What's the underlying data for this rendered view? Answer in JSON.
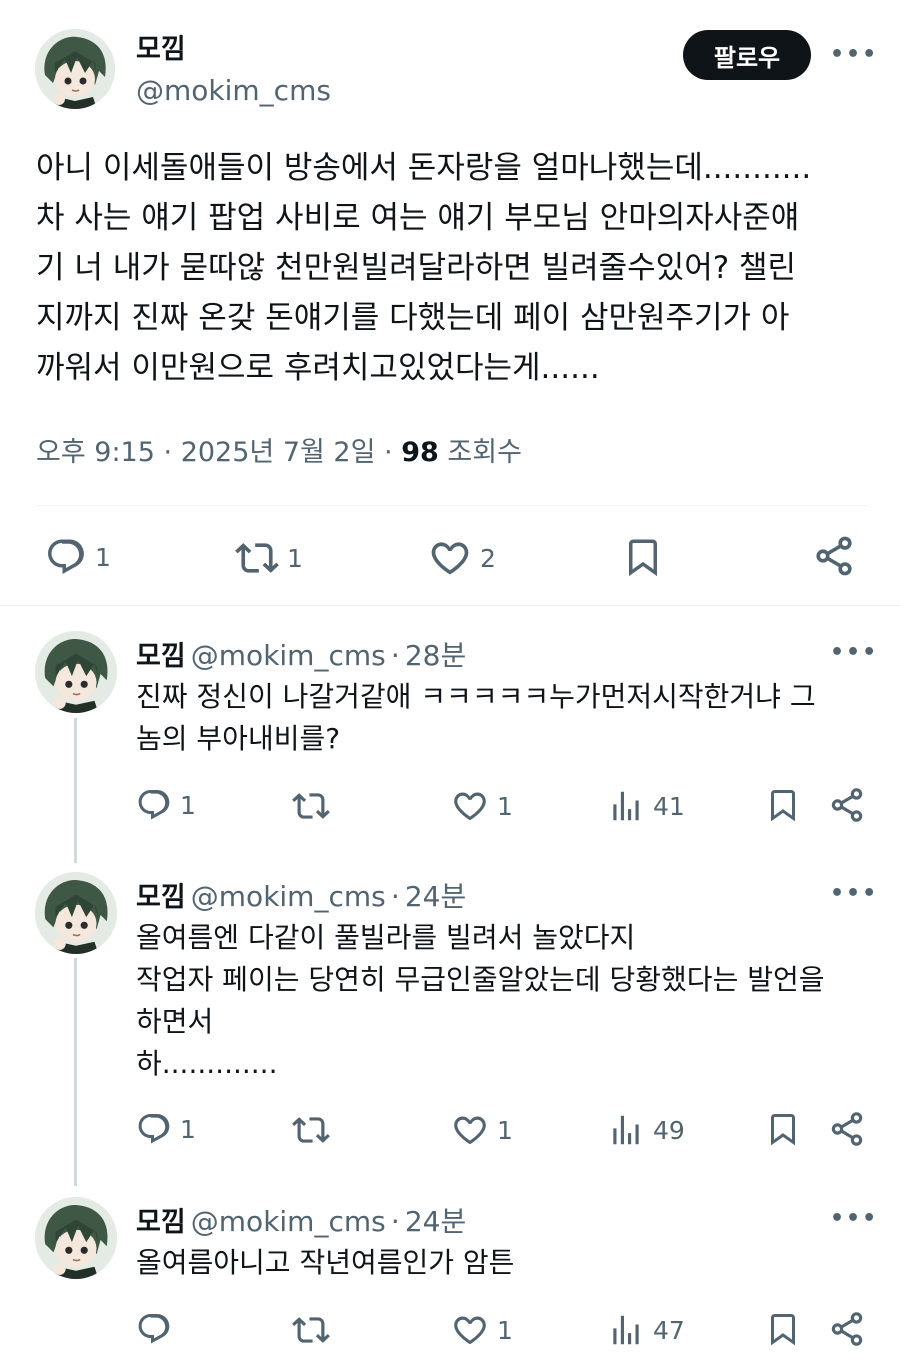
{
  "main_tweet": {
    "author_name": "모낌",
    "author_handle": "@mokim_cms",
    "follow_label": "팔로우",
    "more_label": "•••",
    "text": "아니 이세돌애들이 방송에서 돈자랑을 얼마나했는데...........\n차 사는 얘기 팝업 사비로 여는 얘기 부모님 안마의자사준얘\n기 너 내가 묻따않 천만원빌려달라하면 빌려줄수있어? 챌린\n지까지 진짜 온갖 돈얘기를 다했는데 페이 삼만원주기가 아\n까워서 이만원으로 후려치고있었다는게......",
    "time": "오후 9:15",
    "date": "2025년 7월 2일",
    "views_count": "98",
    "views_label": "조회수",
    "reply_count": "1",
    "retweet_count": "1",
    "like_count": "2"
  },
  "replies": [
    {
      "author_name": "모낌",
      "author_handle": "@mokim_cms",
      "time_ago": "28분",
      "text": "진짜 정신이 나갈거같애 ㅋㅋㅋㅋㅋ누가먼저시작한거냐 그\n놈의 부아내비를?",
      "reply_count": "1",
      "retweet_count": "",
      "like_count": "1",
      "view_count": "41"
    },
    {
      "author_name": "모낌",
      "author_handle": "@mokim_cms",
      "time_ago": "24분",
      "text": "올여름엔 다같이 풀빌라를 빌려서 놀았다지\n작업자 페이는 당연히 무급인줄알았는데 당황했다는 발언을\n하면서\n하.............",
      "reply_count": "1",
      "retweet_count": "",
      "like_count": "1",
      "view_count": "49"
    },
    {
      "author_name": "모낌",
      "author_handle": "@mokim_cms",
      "time_ago": "24분",
      "text": "올여름아니고 작년여름인가 암튼",
      "reply_count": "",
      "retweet_count": "",
      "like_count": "1",
      "view_count": "47"
    }
  ],
  "more_label": "•••",
  "separator": "·",
  "colors": {
    "text": "#0f1419",
    "secondary": "#536471",
    "divider": "#eff3f4",
    "button": "#0f1419"
  }
}
